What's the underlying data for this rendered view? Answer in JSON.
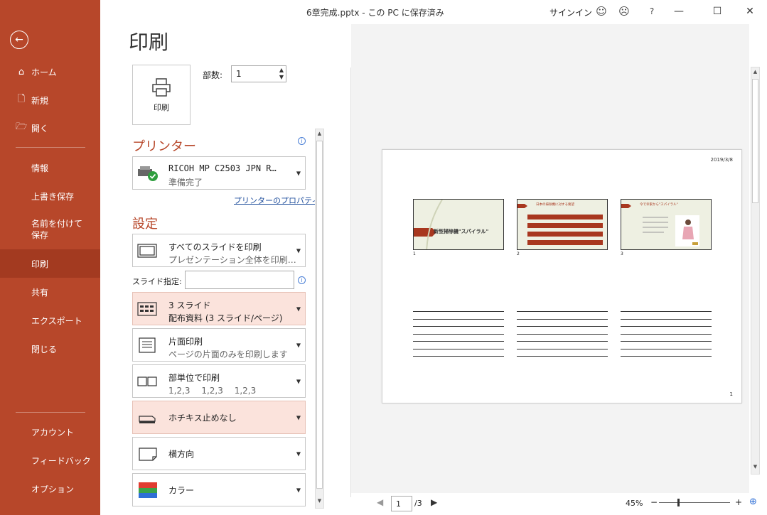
{
  "window": {
    "doc_title": "6章完成.pptx - この PC に保存済み",
    "signin": "サインイン",
    "help": "?",
    "min": "—",
    "max": "☐",
    "close": "✕"
  },
  "sidebar": {
    "items": [
      {
        "label": "ホーム",
        "icon": "⌂"
      },
      {
        "label": "新規",
        "icon": "🗋"
      },
      {
        "label": "開く",
        "icon": "🗁"
      },
      {
        "label": "情報"
      },
      {
        "label": "上書き保存"
      },
      {
        "label": "名前を付けて保存"
      },
      {
        "label": "印刷"
      },
      {
        "label": "共有"
      },
      {
        "label": "エクスポート"
      },
      {
        "label": "閉じる"
      },
      {
        "label": "アカウント"
      },
      {
        "label": "フィードバック"
      },
      {
        "label": "オプション"
      }
    ]
  },
  "main": {
    "title": "印刷",
    "print_button": "印刷",
    "copies_label": "部数:",
    "copies_value": "1",
    "printer_heading": "プリンター",
    "printer_name": "RICOH MP C2503 JPN R…",
    "printer_status": "準備完了",
    "printer_props": "プリンターのプロパティ",
    "settings_heading": "設定",
    "slides_range_l1": "すべてのスライドを印刷",
    "slides_range_l2": "プレゼンテーション全体を印刷…",
    "slide_spec_label": "スライド指定:",
    "layout_l1": "3 スライド",
    "layout_l2": "配布資料 (3 スライド/ページ)",
    "sides_l1": "片面印刷",
    "sides_l2": "ページの片面のみを印刷します",
    "collate_l1": "部単位で印刷",
    "collate_l2": "1,2,3　 1,2,3　 1,2,3",
    "staple": "ホチキス止めなし",
    "orientation": "横方向",
    "color": "カラー"
  },
  "preview": {
    "date": "2019/3/8",
    "page_number": "1",
    "slide1_title": "新型掃除機\"スパイラル\"",
    "slide2_title": "日本の掃除機に対する要望",
    "slide3_title": "今で幸家から\"スパイラル\"",
    "thumb_nums": [
      "1",
      "2",
      "3"
    ],
    "current_page": "1",
    "total_pages": "/3",
    "zoom": "45%"
  },
  "colors": {
    "accent": "#b7472a"
  }
}
